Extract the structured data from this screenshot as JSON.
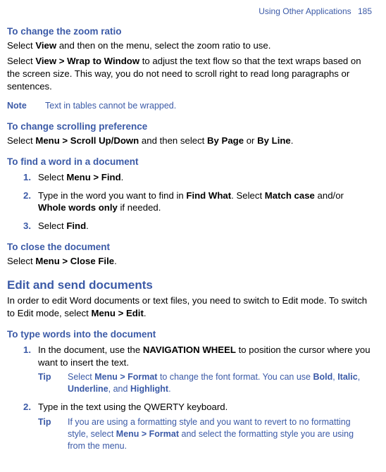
{
  "running_head": {
    "text": "Using Other Applications",
    "page": "185"
  },
  "zoom": {
    "heading": "To change the zoom ratio",
    "p1_a": "Select ",
    "p1_b": "View",
    "p1_c": " and then on the menu, select the zoom ratio to use.",
    "p2_a": "Select ",
    "p2_b": "View > Wrap to Window",
    "p2_c": " to adjust the text flow so that the text wraps based on the screen size. This way, you do not need to scroll right to read long paragraphs or sentences.",
    "note_label": "Note",
    "note_text": "Text in tables cannot be wrapped."
  },
  "scroll": {
    "heading": "To change scrolling preference",
    "a": "Select ",
    "b": "Menu > Scroll Up/Down",
    "c": " and then select ",
    "d": "By Page",
    "e": " or ",
    "f": "By Line",
    "g": "."
  },
  "find": {
    "heading": "To find a word in a document",
    "s1n": "1.",
    "s1a": "Select ",
    "s1b": "Menu > Find",
    "s1c": ".",
    "s2n": "2.",
    "s2a": "Type in the word you want to find in ",
    "s2b": "Find What",
    "s2c": ". Select ",
    "s2d": "Match case",
    "s2e": " and/or ",
    "s2f": "Whole words only",
    "s2g": " if needed.",
    "s3n": "3.",
    "s3a": "Select ",
    "s3b": "Find",
    "s3c": "."
  },
  "close": {
    "heading": "To close the document",
    "a": "Select ",
    "b": "Menu > Close File",
    "c": "."
  },
  "edit": {
    "heading": "Edit and send documents",
    "a": "In order to edit Word documents or text files, you need to switch to Edit mode. To switch to Edit mode, select ",
    "b": "Menu > Edit",
    "c": "."
  },
  "type": {
    "heading": "To type words into the document",
    "s1n": "1.",
    "s1a": "In the document, use the ",
    "s1b": "NAVIGATION WHEEL",
    "s1c": " to position the cursor where you want to insert the text.",
    "tip1_label": "Tip",
    "t1a": "Select ",
    "t1b": "Menu > Format",
    "t1c": " to change the font format. You can use ",
    "t1d": "Bold",
    "t1e": ", ",
    "t1f": "Italic",
    "t1g": ", ",
    "t1h": "Underline",
    "t1i": ", and ",
    "t1j": "Highlight",
    "t1k": ".",
    "s2n": "2.",
    "s2a": "Type in the text using the QWERTY keyboard.",
    "tip2_label": "Tip",
    "t2a": "If you are using a formatting style and you want to revert to no formatting style, select ",
    "t2b": "Menu > Format",
    "t2c": " and select the formatting style you are using from the menu."
  }
}
